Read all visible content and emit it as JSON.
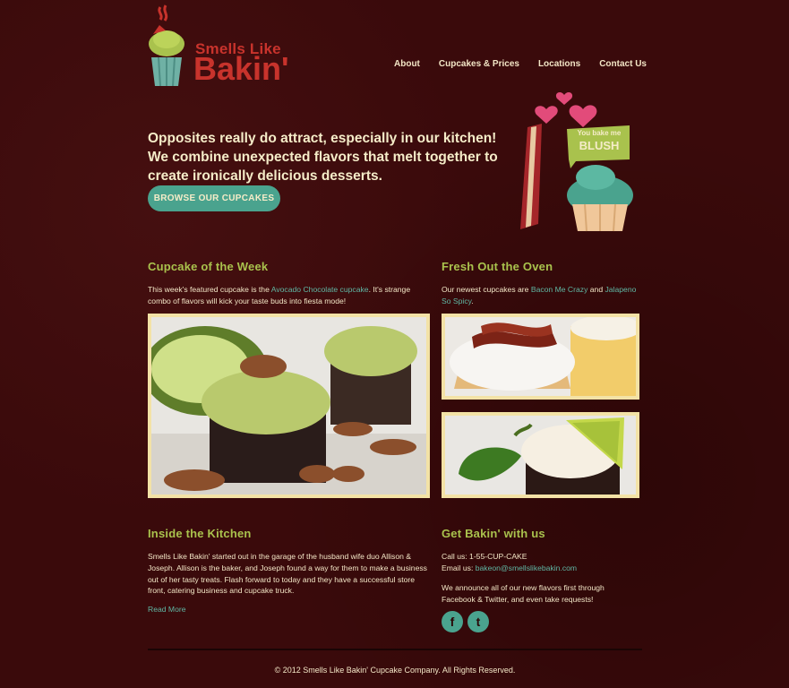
{
  "brand": {
    "name_small": "Smells Like",
    "name_big": "Bakin'"
  },
  "nav": {
    "items": [
      {
        "label": "About"
      },
      {
        "label": "Cupcakes & Prices"
      },
      {
        "label": "Locations"
      },
      {
        "label": "Contact Us"
      }
    ]
  },
  "hero": {
    "text": "Opposites really do attract, especially in our kitchen! We combine unexpected flavors that melt together to create ironically delicious desserts.",
    "button": "BROWSE OUR CUPCAKES",
    "art_badge_line1": "You bake me",
    "art_badge_line2": "BLUSH"
  },
  "cupcake_week": {
    "title": "Cupcake of the Week",
    "text_before": "This week's featured cupcake is the ",
    "link": "Avocado Chocolate cupcake",
    "text_after": ". It's strange combo of flavors will kick your taste buds into fiesta mode!"
  },
  "fresh": {
    "title": "Fresh Out the Oven",
    "text_before": "Our newest cupcakes are ",
    "link1": "Bacon Me Crazy",
    "text_mid": " and ",
    "link2": "Jalapeno So Spicy",
    "text_after": "."
  },
  "kitchen": {
    "title": "Inside the Kitchen",
    "text": "Smells Like Bakin' started out in the garage of the husband wife duo Allison & Joseph. Allison is the baker, and Joseph found a way for them to make a business out of her tasty treats. Flash forward to today and they have a successful store front, catering business and cupcake truck.",
    "read_more": "Read More"
  },
  "contact": {
    "title": "Get Bakin' with us",
    "phone": "Call us: 1-55-CUP-CAKE",
    "email_label": "Email us: ",
    "email": "bakeon@smellslikebakin.com",
    "announce": "We announce all of our new flavors first through Facebook & Twitter, and even take requests!",
    "facebook_glyph": "f",
    "twitter_glyph": "t"
  },
  "footer": {
    "text": "© 2012 Smells Like Bakin' Cupcake Company. All Rights Reserved."
  },
  "colors": {
    "background": "#3a0a0b",
    "accent_green": "#a9c24d",
    "accent_teal": "#4aa38e",
    "logo_red": "#c8332c",
    "frame": "#f3e2a6"
  }
}
